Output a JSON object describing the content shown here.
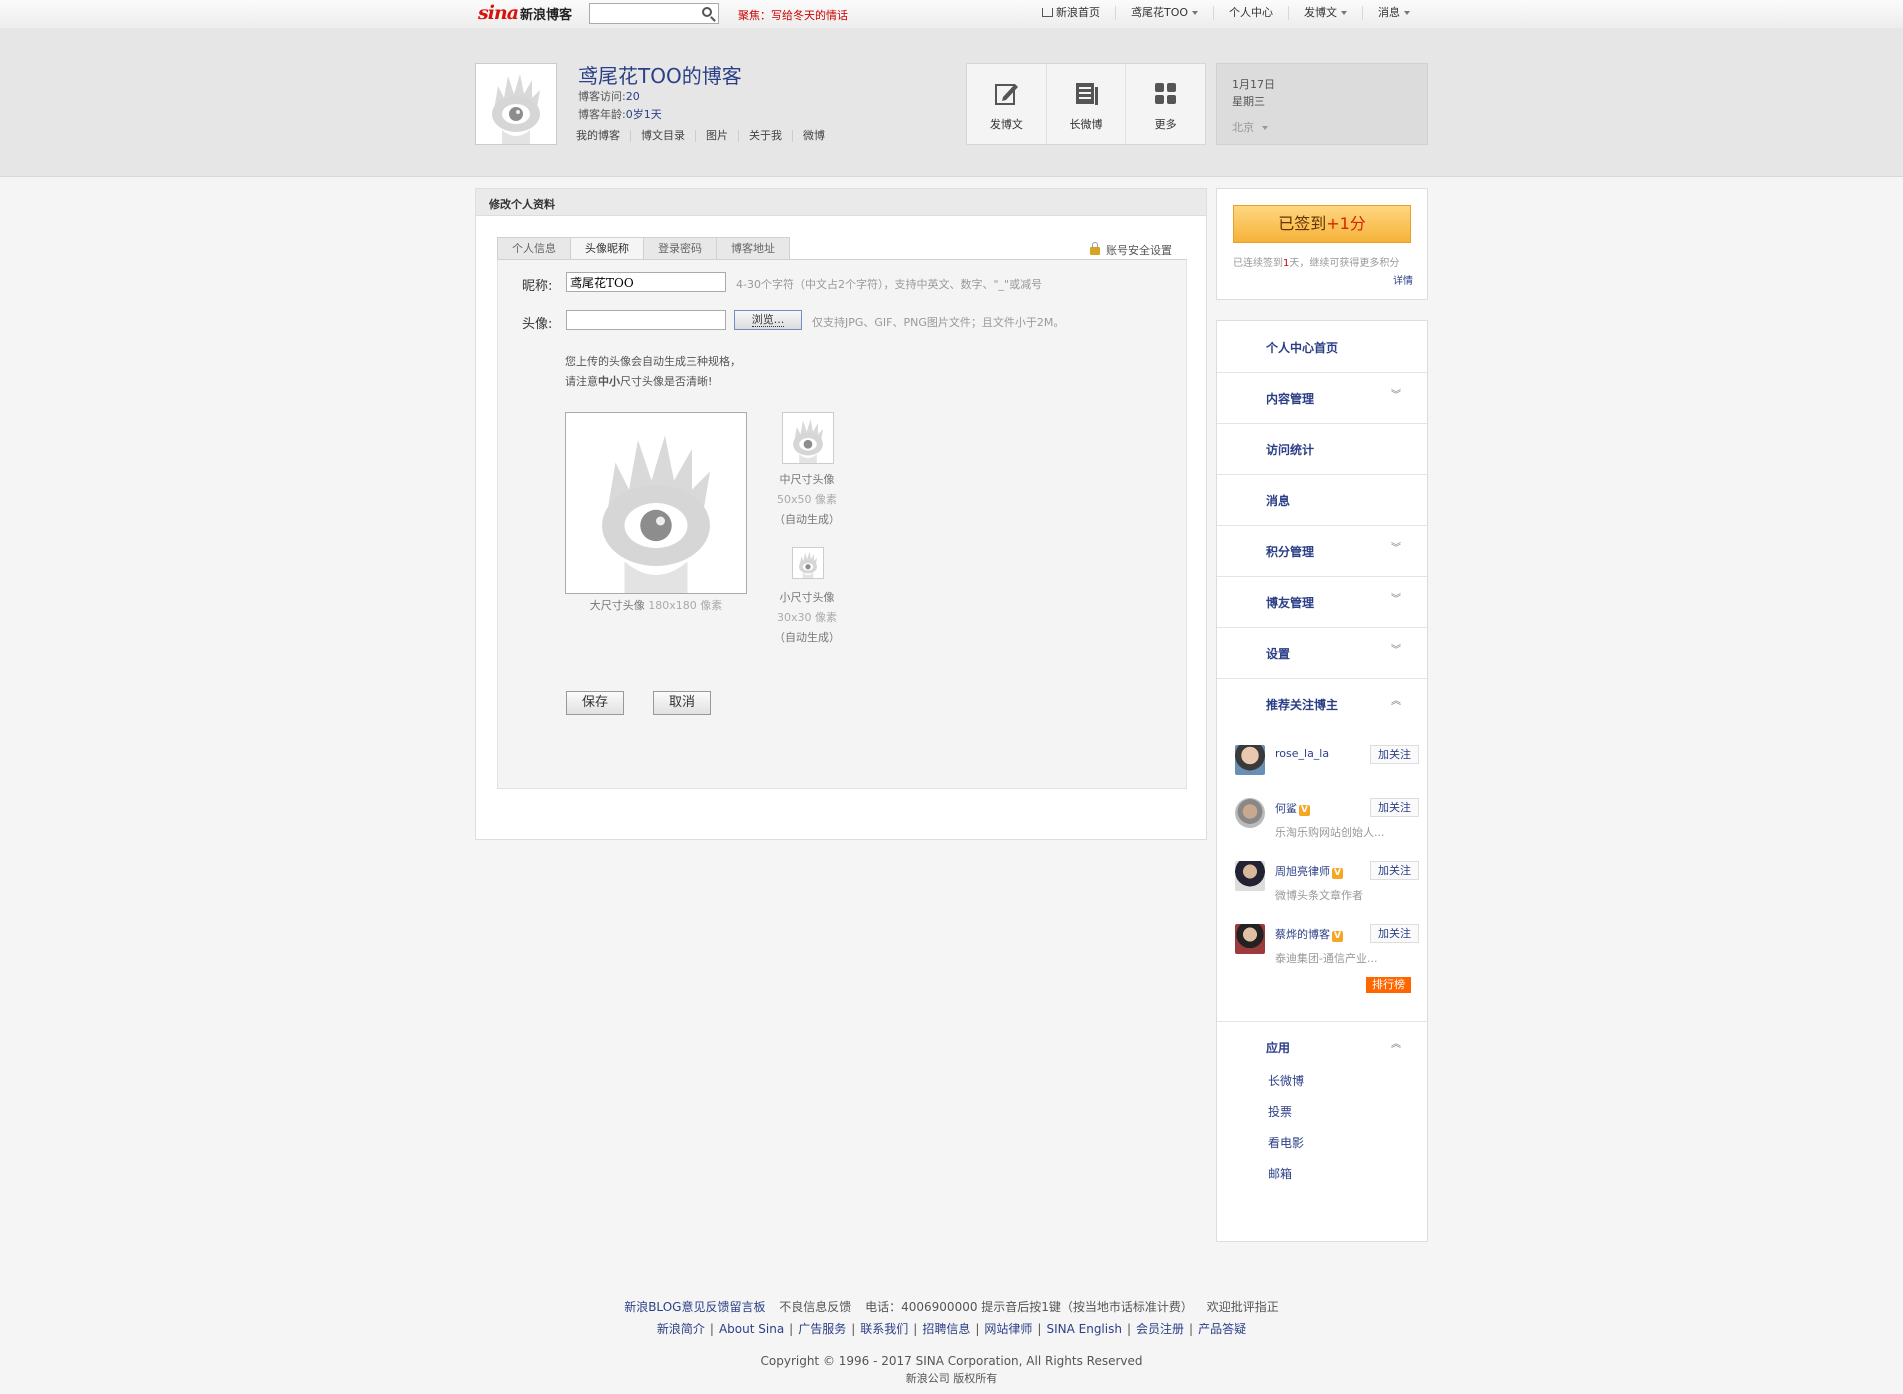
{
  "topbar": {
    "logo_sina": "sina",
    "logo_blog": "新浪博客",
    "search_placeholder": "",
    "notice": "聚焦：写给冬天的情话",
    "items": [
      "新浪首页",
      "鸢尾花TOO",
      "个人中心",
      "发博文",
      "消息"
    ]
  },
  "header": {
    "blog_title": "鸢尾花TOO的博客",
    "visits_label": "博客访问:",
    "visits_value": "20",
    "age_label": "博客年龄:",
    "age_value": "0岁1天",
    "links": [
      "我的博客",
      "博文目录",
      "图片",
      "关于我",
      "微博"
    ],
    "actions": [
      {
        "label": "发博文",
        "icon": "edit-icon"
      },
      {
        "label": "长微博",
        "icon": "long-weibo-icon"
      },
      {
        "label": "更多",
        "icon": "grid-icon"
      }
    ],
    "date": "1月17日",
    "weekday": "星期三",
    "city": "北京"
  },
  "main": {
    "panel_title": "修改个人资料",
    "tabs": [
      "个人信息",
      "头像昵称",
      "登录密码",
      "博客地址"
    ],
    "active_tab": "头像昵称",
    "security_link": "账号安全设置",
    "nickname_label": "昵称:",
    "nickname_value": "鸢尾花TOO",
    "nickname_hint": "4-30个字符（中文占2个字符），支持中英文、数字、\"_\"或减号",
    "avatar_label": "头像:",
    "browse_label": "浏览...",
    "avatar_hint": "仅支持JPG、GIF、PNG图片文件；且文件小于2M。",
    "note_line1": "您上传的头像会自动生成三种规格，",
    "note_line2_pre": "请注意",
    "note_line2_bold": "中小",
    "note_line2_post": "尺寸头像是否清晰!",
    "large_caption": "大尺寸头像",
    "large_size": "180x180 像素",
    "medium_caption": "中尺寸头像",
    "medium_size": "50x50 像素",
    "medium_auto": "（自动生成）",
    "small_caption": "小尺寸头像",
    "small_size": "30x30 像素",
    "small_auto": "（自动生成）",
    "save_label": "保存",
    "cancel_label": "取消"
  },
  "sidebar": {
    "sign_label": "已签到",
    "sign_plus": "+1分",
    "sign_text_pre": "已连续签到",
    "sign_text_days": "1",
    "sign_text_post": "天，继续可获得更多积分",
    "sign_detail": "详情",
    "nav": [
      "个人中心首页",
      "内容管理",
      "访问统计",
      "消息",
      "积分管理",
      "博友管理",
      "设置",
      "推荐关注博主"
    ],
    "recommend": [
      {
        "name": "rose_la_la",
        "desc": "",
        "verified": false,
        "follow": "加关注"
      },
      {
        "name": "何鲨",
        "desc": "乐淘乐购网站创始人...",
        "verified": true,
        "follow": "加关注"
      },
      {
        "name": "周旭亮律师",
        "desc": "微博头条文章作者",
        "verified": true,
        "follow": "加关注"
      },
      {
        "name": "蔡烨的博客",
        "desc": "泰迪集团-通信产业...",
        "verified": true,
        "follow": "加关注"
      }
    ],
    "rank_label": "排行榜",
    "apps_title": "应用",
    "apps": [
      "长微博",
      "投票",
      "看电影",
      "邮箱"
    ]
  },
  "footer": {
    "line1": [
      "新浪BLOG意见反馈留言板",
      "不良信息反馈",
      "电话：4006900000 提示音后按1键（按当地市话标准计费）",
      "欢迎批评指正"
    ],
    "line2": [
      "新浪简介",
      "About Sina",
      "广告服务",
      "联系我们",
      "招聘信息",
      "网站律师",
      "SINA English",
      "会员注册",
      "产品答疑"
    ],
    "copyright": "Copyright © 1996 - 2017 SINA Corporation, All Rights Reserved",
    "company": "新浪公司 版权所有"
  }
}
